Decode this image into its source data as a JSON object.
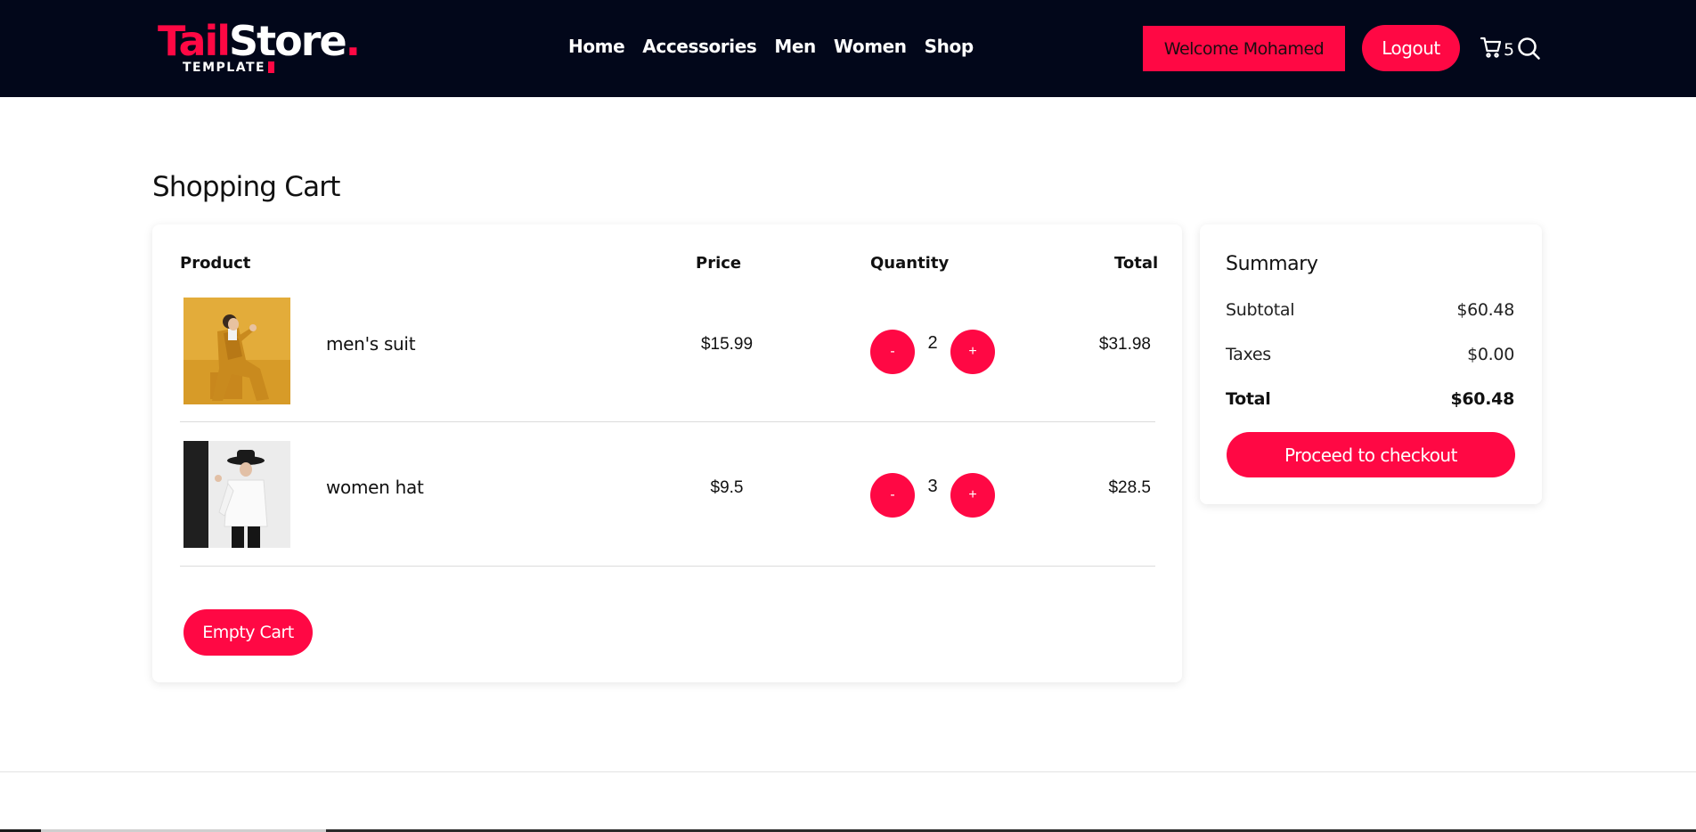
{
  "header": {
    "logo": {
      "part1": "Tail",
      "part2": "Store",
      "dot": ".",
      "sub": "TEMPLATE"
    },
    "nav": [
      "Home",
      "Accessories",
      "Men",
      "Women",
      "Shop"
    ],
    "welcome": "Welcome Mohamed",
    "logout": "Logout",
    "cart_count": "5"
  },
  "page": {
    "title": "Shopping Cart"
  },
  "cart": {
    "columns": {
      "product": "Product",
      "price": "Price",
      "quantity": "Quantity",
      "total": "Total"
    },
    "items": [
      {
        "name": "men's suit",
        "price": "$15.99",
        "qty": "2",
        "total": "$31.98",
        "minus": "-",
        "plus": "+"
      },
      {
        "name": "women hat",
        "price": "$9.5",
        "qty": "3",
        "total": "$28.5",
        "minus": "-",
        "plus": "+"
      }
    ],
    "empty_label": "Empty Cart"
  },
  "summary": {
    "title": "Summary",
    "subtotal_label": "Subtotal",
    "subtotal": "$60.48",
    "taxes_label": "Taxes",
    "taxes": "$0.00",
    "total_label": "Total",
    "total": "$60.48",
    "checkout_label": "Proceed to checkout"
  },
  "colors": {
    "accent": "#ff0844",
    "header_bg": "#02071a"
  },
  "icons": {
    "cart": "cart-icon",
    "search": "search-icon"
  }
}
